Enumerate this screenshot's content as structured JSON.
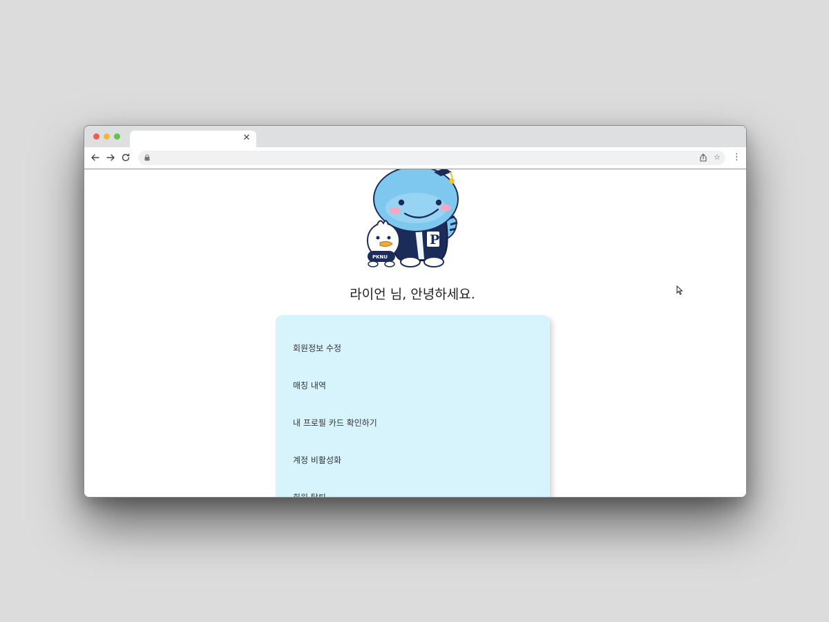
{
  "browser": {
    "tab_title": "",
    "tab_close_icon": "close-icon",
    "url": "",
    "nav_icons": [
      "back-arrow-icon",
      "forward-arrow-icon",
      "reload-icon"
    ],
    "omnibox_icons": [
      "lock-icon",
      "share-icon",
      "star-icon"
    ],
    "menu_icon": "kebab-menu-icon"
  },
  "page": {
    "mascot": "whale-mascot-with-duck",
    "mascot_jacket_letter": "P",
    "mascot_badge_text": "PKNU",
    "greeting": "라이언 님, 안녕하세요.",
    "menu": {
      "items": [
        {
          "label": "회원정보 수정"
        },
        {
          "label": "매칭 내역"
        },
        {
          "label": "내 프로필 카드 확인하기"
        },
        {
          "label": "계정 비활성화"
        },
        {
          "label": "회원 탈퇴"
        }
      ]
    }
  },
  "colors": {
    "desktop_bg": "#dcdcdd",
    "tabstrip": "#dedfe1",
    "menu_card_bg": "#d7f3fc",
    "traffic_red": "#ee5d56",
    "traffic_yellow": "#f3b73a",
    "traffic_green": "#5fc547",
    "mascot_blue": "#7ec8ef",
    "jacket_navy": "#1c2c5a"
  }
}
